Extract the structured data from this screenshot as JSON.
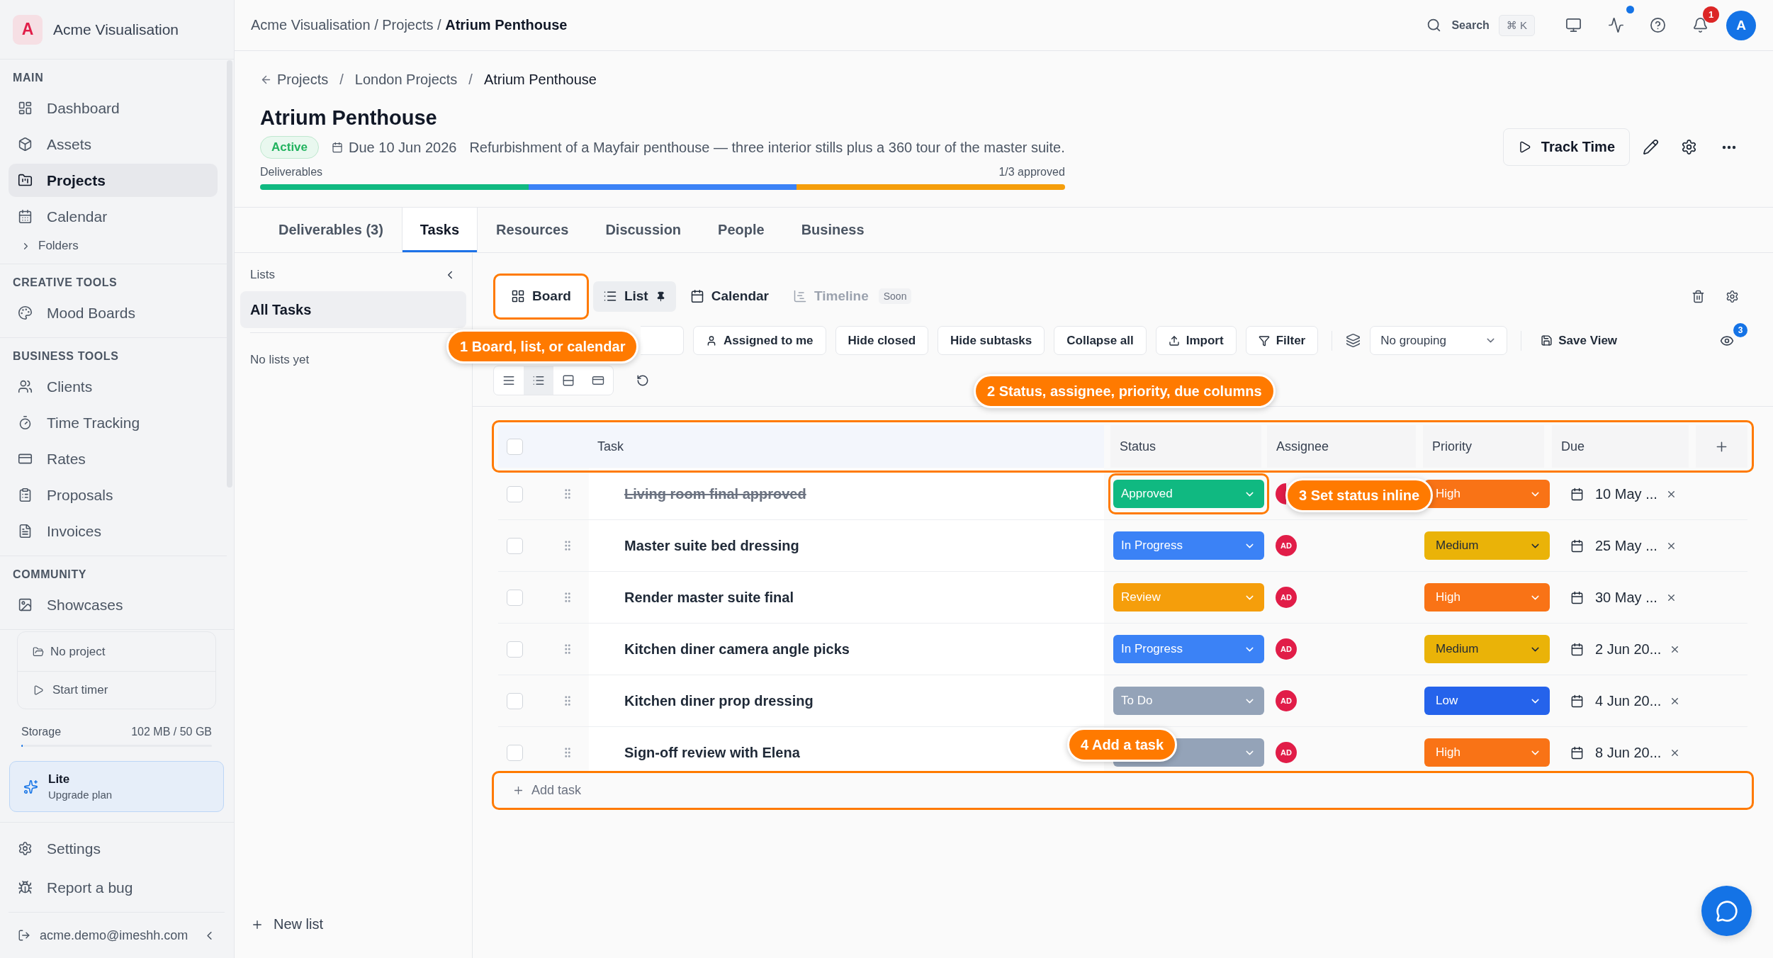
{
  "workspace": {
    "initial": "A",
    "name": "Acme Visualisation"
  },
  "sidebar": {
    "sections": [
      {
        "title": "MAIN",
        "items": [
          {
            "kind": "link",
            "label": "Dashboard",
            "selected": false
          },
          {
            "kind": "link",
            "label": "Assets",
            "selected": false
          },
          {
            "kind": "link",
            "label": "Projects",
            "selected": true
          },
          {
            "kind": "link",
            "label": "Calendar",
            "selected": false
          },
          {
            "kind": "group",
            "label": "Folders",
            "selected": false,
            "expanded": false
          }
        ]
      },
      {
        "title": "CREATIVE TOOLS",
        "items": [
          {
            "kind": "link",
            "label": "Mood Boards",
            "selected": false
          }
        ]
      },
      {
        "title": "BUSINESS TOOLS",
        "items": [
          {
            "kind": "link",
            "label": "Clients",
            "selected": false
          },
          {
            "kind": "link",
            "label": "Time Tracking",
            "selected": false
          },
          {
            "kind": "link",
            "label": "Rates",
            "selected": false
          },
          {
            "kind": "link",
            "label": "Proposals",
            "selected": false
          },
          {
            "kind": "link",
            "label": "Invoices",
            "selected": false
          }
        ]
      },
      {
        "title": "COMMUNITY",
        "items": [
          {
            "kind": "link",
            "label": "Showcases",
            "selected": false
          }
        ]
      }
    ],
    "timer": {
      "project": "No project",
      "action": "Start timer"
    },
    "storage": {
      "label": "Storage",
      "reading": "102 MB / 50 GB",
      "level": 0.002
    },
    "plan": {
      "name": "Lite",
      "action": "Upgrade plan"
    },
    "footer_items": [
      {
        "label": "Settings"
      },
      {
        "label": "Report a bug"
      }
    ],
    "account": {
      "email": "acme.demo@imeshh.com"
    }
  },
  "topbar": {
    "breadcrumb": "Acme Visualisation / Projects / **Atrium Penthouse**",
    "search": {
      "label": "Search",
      "shortcut": "⌘ K"
    },
    "activity_unread": true,
    "notification_count": "1",
    "avatar_initial": "A"
  },
  "project": {
    "breadcrumb": {
      "items": [
        {
          "label": "Projects",
          "current": false
        },
        {
          "label": "London Projects",
          "current": false
        },
        {
          "label": "Atrium Penthouse",
          "current": true
        }
      ],
      "separators": [
        "/",
        "/"
      ]
    },
    "title": "Atrium Penthouse",
    "status": "Active",
    "due": "Due 10 Jun 2026",
    "description": "Refurbishment of a Mayfair penthouse — three interior stills plus a 360 tour of the master suite.",
    "progress": {
      "label": "Deliverables",
      "reading": "1/3 approved",
      "segments": [
        {
          "color": "#10b981"
        },
        {
          "color": "#3b82f6"
        },
        {
          "color": "#f59e0b"
        }
      ]
    },
    "track_time": "Track Time"
  },
  "tabs": [
    {
      "label": "Deliverables (3)",
      "selected": false
    },
    {
      "label": "Tasks",
      "selected": true
    },
    {
      "label": "Resources",
      "selected": false
    },
    {
      "label": "Discussion",
      "selected": false
    },
    {
      "label": "People",
      "selected": false
    },
    {
      "label": "Business",
      "selected": false
    }
  ],
  "lists_panel": {
    "title": "Lists",
    "items": [
      {
        "label": "All Tasks",
        "selected": true
      }
    ],
    "empty_text": "No lists yet",
    "new_list": "New list"
  },
  "views": [
    {
      "kind": "board",
      "label": "Board",
      "selected": false,
      "highlighted": true,
      "pinned": false,
      "disabled": false
    },
    {
      "kind": "list",
      "label": "List",
      "selected": true,
      "highlighted": false,
      "pinned": true,
      "disabled": false
    },
    {
      "kind": "calendar",
      "label": "Calendar",
      "selected": false,
      "highlighted": false,
      "pinned": false,
      "disabled": false
    },
    {
      "kind": "timeline",
      "label": "Timeline",
      "selected": false,
      "highlighted": false,
      "pinned": false,
      "disabled": true,
      "badge": "Soon"
    }
  ],
  "toolbar": {
    "buttons": [
      {
        "kind": "assigned",
        "label": "Assigned to me"
      },
      {
        "kind": "plain",
        "label": "Hide closed"
      },
      {
        "kind": "plain",
        "label": "Hide subtasks"
      },
      {
        "kind": "plain",
        "label": "Collapse all"
      },
      {
        "kind": "import",
        "label": "Import"
      },
      {
        "kind": "filter",
        "label": "Filter"
      }
    ],
    "grouping": "No grouping",
    "save_view": "Save View",
    "visibility_badge": "3",
    "density": [
      {
        "kind": "lines",
        "selected": false
      },
      {
        "kind": "list",
        "selected": true
      },
      {
        "kind": "rows",
        "selected": false
      },
      {
        "kind": "cards",
        "selected": false
      }
    ]
  },
  "table": {
    "highlighted": true,
    "select_all_checked": false,
    "columns": [
      "Task",
      "Status",
      "Assignee",
      "Priority",
      "Due"
    ],
    "rows": [
      {
        "title": "Living room final approved",
        "completed": true,
        "checked": false,
        "status": {
          "label": "Approved",
          "color": "#10b981",
          "highlighted": true
        },
        "assignee": {
          "kind": "avatar"
        },
        "priority": {
          "label": "High",
          "color": "#f97316"
        },
        "due": "10 May ..."
      },
      {
        "title": "Master suite bed dressing",
        "completed": false,
        "checked": false,
        "status": {
          "label": "In Progress",
          "color": "#3b82f6",
          "highlighted": false
        },
        "assignee": {
          "kind": "avatar",
          "initials": "AD"
        },
        "priority": {
          "label": "Medium",
          "color": "#eab308"
        },
        "due": "25 May ..."
      },
      {
        "title": "Render master suite final",
        "completed": false,
        "checked": false,
        "status": {
          "label": "Review",
          "color": "#f59e0b",
          "highlighted": false
        },
        "assignee": {
          "kind": "avatar",
          "initials": "AD"
        },
        "priority": {
          "label": "High",
          "color": "#f97316"
        },
        "due": "30 May ..."
      },
      {
        "title": "Kitchen diner camera angle picks",
        "completed": false,
        "checked": false,
        "status": {
          "label": "In Progress",
          "color": "#3b82f6",
          "highlighted": false
        },
        "assignee": {
          "kind": "avatar",
          "initials": "AD"
        },
        "priority": {
          "label": "Medium",
          "color": "#eab308"
        },
        "due": "2 Jun 20..."
      },
      {
        "title": "Kitchen diner prop dressing",
        "completed": false,
        "checked": false,
        "status": {
          "label": "To Do",
          "color": "#94a3b8",
          "highlighted": false
        },
        "assignee": {
          "kind": "avatar",
          "initials": "AD"
        },
        "priority": {
          "label": "Low",
          "color": "#2563eb"
        },
        "due": "4 Jun 20..."
      },
      {
        "title": "Sign-off review with Elena",
        "completed": false,
        "checked": false,
        "status": {
          "color": "#94a3b8",
          "highlighted": false
        },
        "assignee": {
          "kind": "avatar",
          "initials": "AD"
        },
        "priority": {
          "label": "High",
          "color": "#f97316"
        },
        "due": "8 Jun 20..."
      }
    ]
  },
  "add_task": {
    "label": "Add task",
    "highlighted": true
  },
  "callouts": [
    "1 Board, list, or calendar",
    "2 Status, assignee, priority, due columns",
    "3 Set status inline",
    "4 Add a task"
  ]
}
